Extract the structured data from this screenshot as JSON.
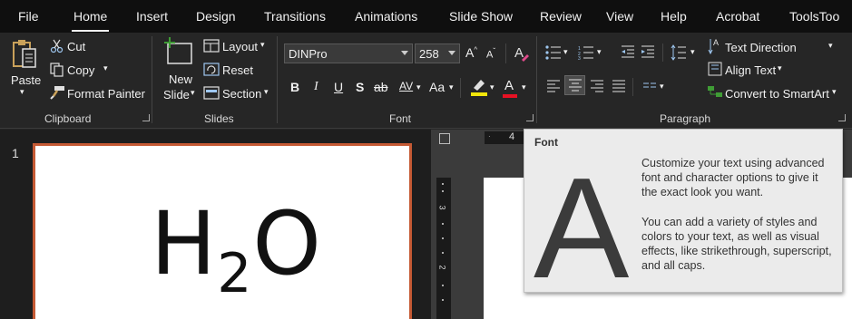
{
  "tabs": [
    {
      "label": "File"
    },
    {
      "label": "Home"
    },
    {
      "label": "Insert"
    },
    {
      "label": "Design"
    },
    {
      "label": "Transitions"
    },
    {
      "label": "Animations"
    },
    {
      "label": "Slide Show"
    },
    {
      "label": "Review"
    },
    {
      "label": "View"
    },
    {
      "label": "Help"
    },
    {
      "label": "Acrobat"
    },
    {
      "label": "ToolsToo"
    }
  ],
  "active_tab": "Home",
  "clipboard": {
    "paste_label": "Paste",
    "cut_label": "Cut",
    "copy_label": "Copy",
    "format_painter_label": "Format Painter",
    "group_label": "Clipboard"
  },
  "slides_group": {
    "new_slide_label_1": "New",
    "new_slide_label_2": "Slide",
    "layout_label": "Layout",
    "reset_label": "Reset",
    "section_label": "Section",
    "group_label": "Slides"
  },
  "font_group": {
    "font_name": "DINPro",
    "font_size": "258",
    "bold": "B",
    "italic": "I",
    "underline": "U",
    "shadow": "S",
    "strike": "ab",
    "spacing": "AV",
    "change_case": "Aa",
    "grow": "A",
    "shrink": "A",
    "font_color": "A",
    "group_label": "Font"
  },
  "paragraph_group": {
    "text_direction_label": "Text Direction",
    "align_text_label": "Align Text",
    "convert_smartart_label": "Convert to SmartArt",
    "group_label": "Paragraph"
  },
  "slides_pane": {
    "slide_number": "1",
    "slide_text_main_1": "H",
    "slide_text_sub": "2",
    "slide_text_main_2": "O"
  },
  "ruler": {
    "h_tick": "4",
    "v_tick_3": "3",
    "v_tick_2": "2"
  },
  "tooltip": {
    "title": "Font",
    "letter": "A",
    "paragraph_1": "Customize your text using advanced font and character options to give it the exact look you want.",
    "paragraph_2": "You can add a variety of styles and colors to your text, as well as visual effects, like strikethrough, superscript, and all caps."
  },
  "colors": {
    "accent_slide_border": "#c55a34",
    "highlight_yellow": "#f2e60a",
    "font_color_red": "#e81123",
    "smartart_green": "#3f9c35"
  }
}
